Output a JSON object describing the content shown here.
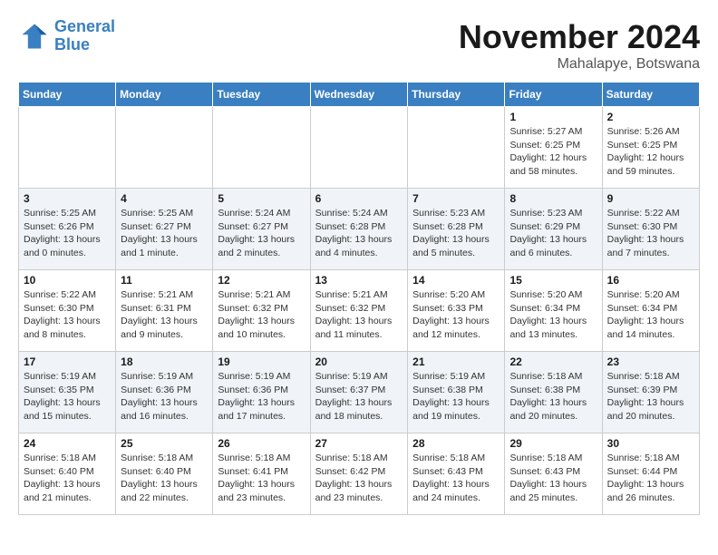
{
  "logo": {
    "line1": "General",
    "line2": "Blue"
  },
  "title": "November 2024",
  "location": "Mahalapye, Botswana",
  "weekdays": [
    "Sunday",
    "Monday",
    "Tuesday",
    "Wednesday",
    "Thursday",
    "Friday",
    "Saturday"
  ],
  "weeks": [
    [
      {
        "day": "",
        "info": ""
      },
      {
        "day": "",
        "info": ""
      },
      {
        "day": "",
        "info": ""
      },
      {
        "day": "",
        "info": ""
      },
      {
        "day": "",
        "info": ""
      },
      {
        "day": "1",
        "info": "Sunrise: 5:27 AM\nSunset: 6:25 PM\nDaylight: 12 hours\nand 58 minutes."
      },
      {
        "day": "2",
        "info": "Sunrise: 5:26 AM\nSunset: 6:25 PM\nDaylight: 12 hours\nand 59 minutes."
      }
    ],
    [
      {
        "day": "3",
        "info": "Sunrise: 5:25 AM\nSunset: 6:26 PM\nDaylight: 13 hours\nand 0 minutes."
      },
      {
        "day": "4",
        "info": "Sunrise: 5:25 AM\nSunset: 6:27 PM\nDaylight: 13 hours\nand 1 minute."
      },
      {
        "day": "5",
        "info": "Sunrise: 5:24 AM\nSunset: 6:27 PM\nDaylight: 13 hours\nand 2 minutes."
      },
      {
        "day": "6",
        "info": "Sunrise: 5:24 AM\nSunset: 6:28 PM\nDaylight: 13 hours\nand 4 minutes."
      },
      {
        "day": "7",
        "info": "Sunrise: 5:23 AM\nSunset: 6:28 PM\nDaylight: 13 hours\nand 5 minutes."
      },
      {
        "day": "8",
        "info": "Sunrise: 5:23 AM\nSunset: 6:29 PM\nDaylight: 13 hours\nand 6 minutes."
      },
      {
        "day": "9",
        "info": "Sunrise: 5:22 AM\nSunset: 6:30 PM\nDaylight: 13 hours\nand 7 minutes."
      }
    ],
    [
      {
        "day": "10",
        "info": "Sunrise: 5:22 AM\nSunset: 6:30 PM\nDaylight: 13 hours\nand 8 minutes."
      },
      {
        "day": "11",
        "info": "Sunrise: 5:21 AM\nSunset: 6:31 PM\nDaylight: 13 hours\nand 9 minutes."
      },
      {
        "day": "12",
        "info": "Sunrise: 5:21 AM\nSunset: 6:32 PM\nDaylight: 13 hours\nand 10 minutes."
      },
      {
        "day": "13",
        "info": "Sunrise: 5:21 AM\nSunset: 6:32 PM\nDaylight: 13 hours\nand 11 minutes."
      },
      {
        "day": "14",
        "info": "Sunrise: 5:20 AM\nSunset: 6:33 PM\nDaylight: 13 hours\nand 12 minutes."
      },
      {
        "day": "15",
        "info": "Sunrise: 5:20 AM\nSunset: 6:34 PM\nDaylight: 13 hours\nand 13 minutes."
      },
      {
        "day": "16",
        "info": "Sunrise: 5:20 AM\nSunset: 6:34 PM\nDaylight: 13 hours\nand 14 minutes."
      }
    ],
    [
      {
        "day": "17",
        "info": "Sunrise: 5:19 AM\nSunset: 6:35 PM\nDaylight: 13 hours\nand 15 minutes."
      },
      {
        "day": "18",
        "info": "Sunrise: 5:19 AM\nSunset: 6:36 PM\nDaylight: 13 hours\nand 16 minutes."
      },
      {
        "day": "19",
        "info": "Sunrise: 5:19 AM\nSunset: 6:36 PM\nDaylight: 13 hours\nand 17 minutes."
      },
      {
        "day": "20",
        "info": "Sunrise: 5:19 AM\nSunset: 6:37 PM\nDaylight: 13 hours\nand 18 minutes."
      },
      {
        "day": "21",
        "info": "Sunrise: 5:19 AM\nSunset: 6:38 PM\nDaylight: 13 hours\nand 19 minutes."
      },
      {
        "day": "22",
        "info": "Sunrise: 5:18 AM\nSunset: 6:38 PM\nDaylight: 13 hours\nand 20 minutes."
      },
      {
        "day": "23",
        "info": "Sunrise: 5:18 AM\nSunset: 6:39 PM\nDaylight: 13 hours\nand 20 minutes."
      }
    ],
    [
      {
        "day": "24",
        "info": "Sunrise: 5:18 AM\nSunset: 6:40 PM\nDaylight: 13 hours\nand 21 minutes."
      },
      {
        "day": "25",
        "info": "Sunrise: 5:18 AM\nSunset: 6:40 PM\nDaylight: 13 hours\nand 22 minutes."
      },
      {
        "day": "26",
        "info": "Sunrise: 5:18 AM\nSunset: 6:41 PM\nDaylight: 13 hours\nand 23 minutes."
      },
      {
        "day": "27",
        "info": "Sunrise: 5:18 AM\nSunset: 6:42 PM\nDaylight: 13 hours\nand 23 minutes."
      },
      {
        "day": "28",
        "info": "Sunrise: 5:18 AM\nSunset: 6:43 PM\nDaylight: 13 hours\nand 24 minutes."
      },
      {
        "day": "29",
        "info": "Sunrise: 5:18 AM\nSunset: 6:43 PM\nDaylight: 13 hours\nand 25 minutes."
      },
      {
        "day": "30",
        "info": "Sunrise: 5:18 AM\nSunset: 6:44 PM\nDaylight: 13 hours\nand 26 minutes."
      }
    ]
  ]
}
